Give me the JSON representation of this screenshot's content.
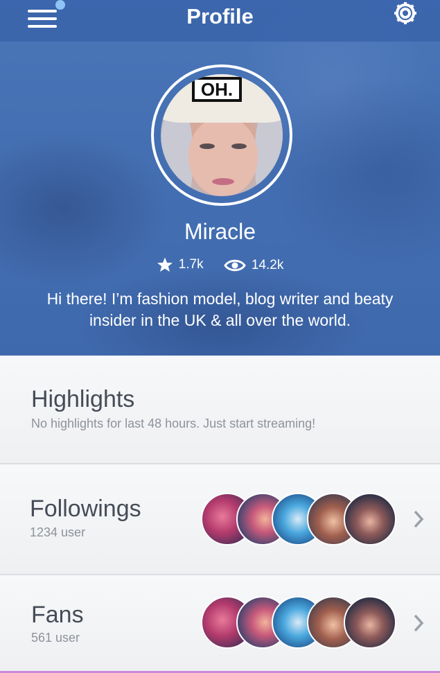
{
  "header": {
    "title": "Profile",
    "menu_icon": "hamburger-menu-icon",
    "settings_icon": "gear-icon"
  },
  "profile": {
    "name": "Miracle",
    "stars": "1.7k",
    "views": "14.2k",
    "beanie_text": "OH.",
    "bio": "Hi there! I’m fashion model, blog writer and beaty insider in the UK & all over the world."
  },
  "highlights": {
    "title": "Highlights",
    "subtitle": "No highlights for last 48 hours. Just start streaming!"
  },
  "followings": {
    "title": "Followings",
    "subtitle": "1234 user"
  },
  "fans": {
    "title": "Fans",
    "subtitle": "561 user"
  },
  "colors": {
    "hero": "#4470b3",
    "accent_dot": "#8ec3f5",
    "section_title": "#454c57",
    "section_sub": "#8e929a"
  }
}
